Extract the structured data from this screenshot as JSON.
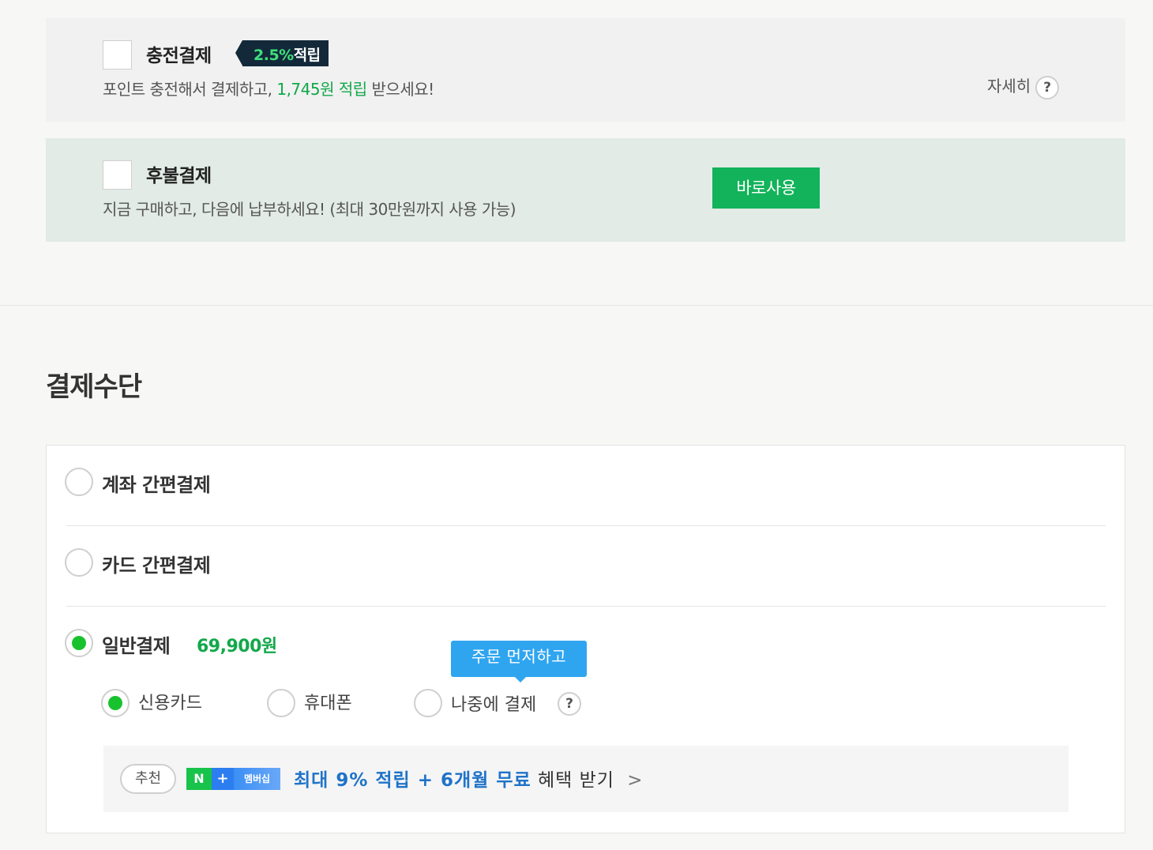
{
  "charge_option": {
    "title": "충전결제",
    "badge_pct": "2.5%",
    "badge_text": "적립",
    "desc_prefix": "포인트 충전해서 결제하고,",
    "desc_highlight": "1,745원 적립",
    "desc_suffix": "받으세요!",
    "detail_label": "자세히",
    "help_icon": "?"
  },
  "later_option": {
    "title": "후불결제",
    "desc": "지금 구매하고, 다음에 납부하세요! (최대 30만원까지 사용 가능)",
    "use_button": "바로사용"
  },
  "payment_section": {
    "title": "결제수단",
    "methods": [
      {
        "label": "계좌 간편결제",
        "selected": false
      },
      {
        "label": "카드 간편결제",
        "selected": false
      },
      {
        "label": "일반결제",
        "amount": "69,900원",
        "selected": true
      }
    ],
    "sub_methods": [
      {
        "label": "신용카드",
        "selected": true
      },
      {
        "label": "휴대폰",
        "selected": false
      },
      {
        "label": "나중에 결제",
        "selected": false
      }
    ],
    "tooltip": "주문 먼저하고",
    "help_icon": "?",
    "promo": {
      "pill": "추천",
      "nplus_n": "N",
      "nplus_plus": "+",
      "nplus_member": "멤버십",
      "highlight": "최대 9% 적립 + 6개월 무료",
      "rest": "혜택 받기",
      "chevron": ">"
    }
  },
  "colors": {
    "accent_green": "#12a84a",
    "radio_green": "#18c22f",
    "button_green": "#12b35a",
    "tooltip_blue": "#2fa5f0",
    "promo_blue": "#1f73c9"
  }
}
